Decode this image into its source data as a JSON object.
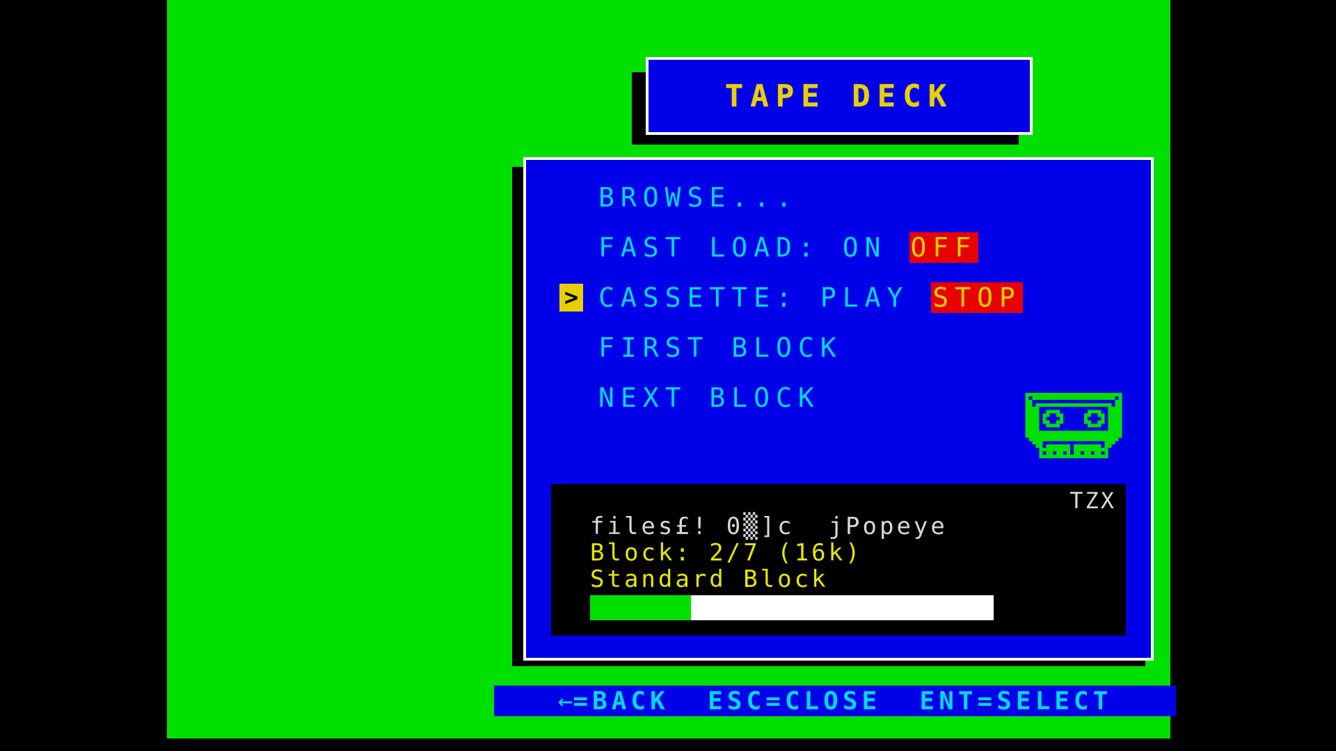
{
  "palette": {
    "screen_black": "#000000",
    "paper_green": "#00e000",
    "window_blue": "#0000e8",
    "border_white": "#ffffff",
    "shadow_black": "#000000",
    "text_cyan": "#00d8e8",
    "text_yellow": "#e8d000",
    "highlight_red": "#e80000",
    "info_white": "#d8d8d8",
    "info_yellow": "#e8e800"
  },
  "title_window": {
    "title": "TAPE DECK"
  },
  "menu": {
    "items": [
      {
        "label": "BROWSE...",
        "selected": false,
        "options": []
      },
      {
        "label": "FAST LOAD:",
        "selected": false,
        "options": [
          {
            "text": "ON",
            "active": false
          },
          {
            "text": "OFF",
            "active": true
          }
        ]
      },
      {
        "label": "CASSETTE:",
        "selected": true,
        "options": [
          {
            "text": "PLAY",
            "active": false
          },
          {
            "text": "STOP",
            "active": true
          }
        ]
      },
      {
        "label": "FIRST BLOCK",
        "selected": false,
        "options": []
      },
      {
        "label": "NEXT BLOCK",
        "selected": false,
        "options": []
      }
    ],
    "cursor_glyph": ">"
  },
  "cassette_icon": {
    "name": "cassette-tape-icon",
    "color": "#00e000"
  },
  "info_panel": {
    "format": "TZX",
    "filename": "files£! 0▒]c  jPopeye",
    "block_line": "Block: 2/7 (16k)",
    "block_type": "Standard Block",
    "progress_percent": 25
  },
  "status_bar": {
    "back_arrow": "←",
    "text": "=BACK  ESC=CLOSE  ENT=SELECT"
  }
}
